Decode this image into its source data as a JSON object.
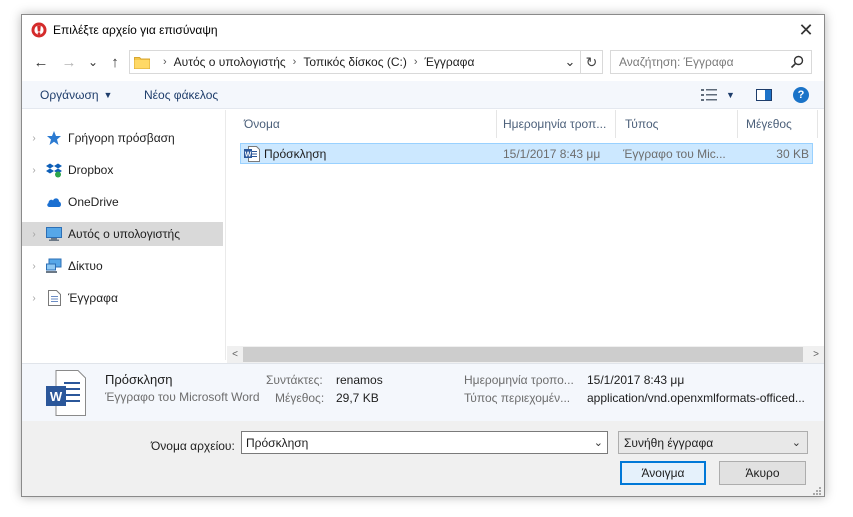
{
  "window": {
    "title": "Επιλέξτε αρχείο για επισύναψη",
    "close_symbol": "✕"
  },
  "navigation": {
    "back_icon": "←",
    "forward_icon": "→",
    "recent_icon": "⌄",
    "up_icon": "↑",
    "breadcrumbs": [
      "Αυτός ο υπολογιστής",
      "Τοπικός δίσκος (C:)",
      "Έγγραφα"
    ],
    "separator": "›",
    "refresh_icon": "↻",
    "search_placeholder": "Αναζήτηση: Έγγραφα"
  },
  "toolbar": {
    "organize_label": "Οργάνωση",
    "new_folder_label": "Νέος φάκελος",
    "dropdown_symbol": "▼",
    "help_symbol": "?"
  },
  "sidebar": {
    "items": [
      {
        "label": "Γρήγορη πρόσβαση",
        "icon": "star-icon"
      },
      {
        "label": "Dropbox",
        "icon": "dropbox-icon"
      },
      {
        "label": "OneDrive",
        "icon": "cloud-icon"
      },
      {
        "label": "Αυτός ο υπολογιστής",
        "icon": "computer-icon"
      },
      {
        "label": "Δίκτυο",
        "icon": "network-icon"
      },
      {
        "label": "Έγγραφα",
        "icon": "document-icon"
      }
    ],
    "expand_symbol": "›",
    "selected_index": 3
  },
  "filelist": {
    "columns": [
      "Όνομα",
      "Ημερομηνία τροπ...",
      "Τύπος",
      "Μέγεθος"
    ],
    "sort_indicator": "^",
    "rows": [
      {
        "name": "Πρόσκληση",
        "date": "15/1/2017 8:43 μμ",
        "type": "Έγγραφο του Mic...",
        "size": "30 KB"
      }
    ]
  },
  "scrollbar": {
    "left_arrow": "<",
    "right_arrow": ">"
  },
  "details": {
    "file_name": "Πρόσκληση",
    "file_type": "Έγγραφο του Microsoft Word",
    "authors_label": "Συντάκτες:",
    "authors_value": "renamos",
    "size_label": "Μέγεθος:",
    "size_value": "29,7 KB",
    "modified_label": "Ημερομηνία τροπο...",
    "modified_value": "15/1/2017 8:43 μμ",
    "content_type_label": "Τύπος περιεχομέν...",
    "content_type_value": "application/vnd.openxmlformats-officed..."
  },
  "footer": {
    "filename_label": "Όνομα αρχείου:",
    "filename_value": "Πρόσκληση",
    "dropdown_symbol": "⌄",
    "filetype_value": "Συνήθη έγγραφα",
    "open_label": "Άνοιγμα",
    "cancel_label": "Άκυρο"
  },
  "colors": {
    "accent": "#0078d7",
    "selection_bg": "#cce8ff",
    "selection_border": "#99d1ff",
    "word_blue": "#2b579a",
    "help_blue": "#1a73c8"
  }
}
